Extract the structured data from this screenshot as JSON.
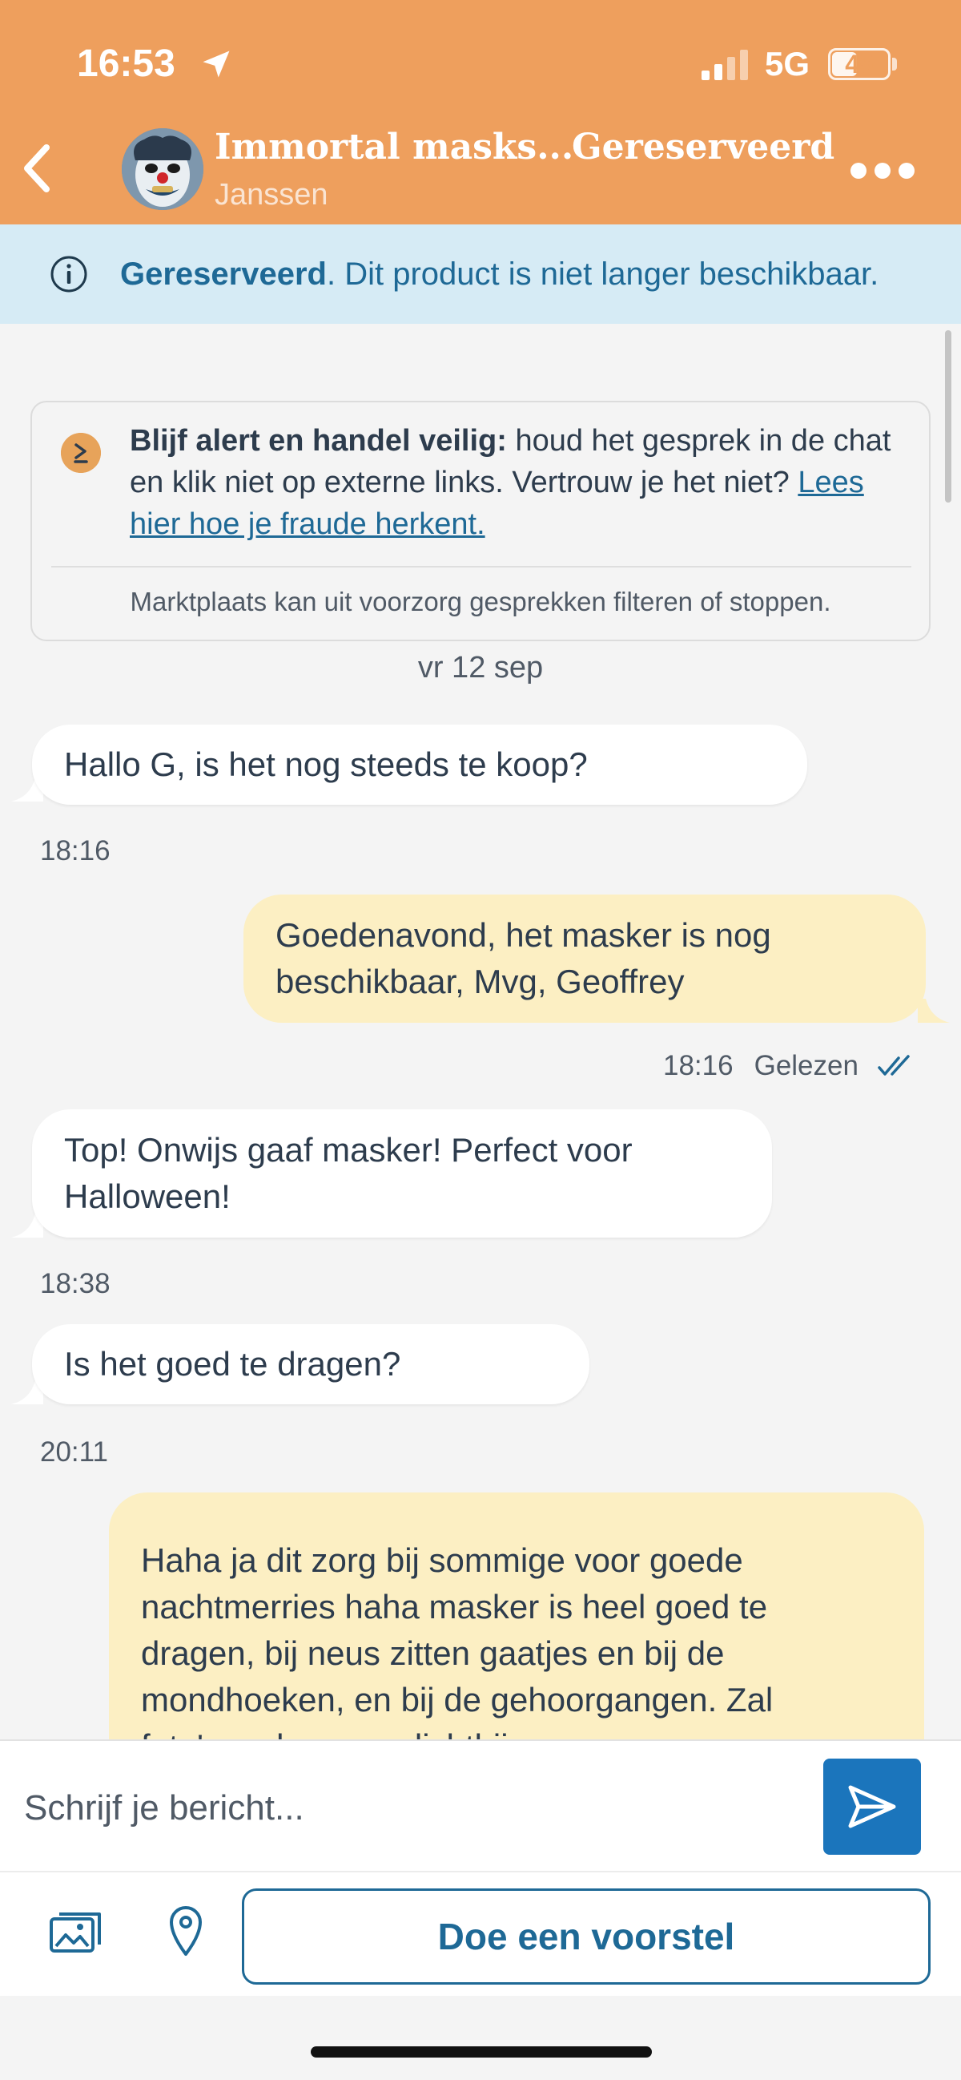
{
  "status_bar": {
    "time": "16:53",
    "network": "5G",
    "battery": "45",
    "battery_level": 0.45
  },
  "header": {
    "title": "Immortal masks...",
    "subtitle": "Janssen",
    "status": "Gereserveerd"
  },
  "banner": {
    "bold": "Gereserveerd",
    "text": ". Dit product is niet langer beschikbaar."
  },
  "safety": {
    "bold": "Blijf alert en handel veilig:",
    "text": " houd het gesprek in de chat en klik niet op externe links. Vertrouw je het niet? ",
    "link": "Lees hier hoe je fraude herkent.",
    "note": "Marktplaats kan uit voorzorg gesprekken filteren of stoppen."
  },
  "date_separator": "vr 12 sep",
  "messages": [
    {
      "direction": "in",
      "text": "Hallo G, is het nog steeds te koop?",
      "time": "18:16"
    },
    {
      "direction": "out",
      "line1": "Goedenavond, het masker is nog",
      "line2": "beschikbaar, Mvg, Geoffrey",
      "time": "18:16",
      "status": "Gelezen"
    },
    {
      "direction": "in",
      "line1": "Top! Onwijs gaaf masker! Perfect voor",
      "line2": "Halloween!",
      "time": "18:38"
    },
    {
      "direction": "in",
      "text": "Is het goed te dragen?",
      "time": "20:11"
    },
    {
      "direction": "out",
      "lines": [
        "Haha ja dit zorg bij sommige voor goede",
        "nachtmerries haha masker is heel goed te",
        "dragen, bij neus zitten gaatjes en bij de",
        "mondhoeken, en bij de gehoorgangen. Zal",
        "foto's maken van dichtbij"
      ]
    }
  ],
  "composer": {
    "placeholder": "Schrijf je bericht..."
  },
  "actions": {
    "offer_label": "Doe een voorstel"
  },
  "colors": {
    "header": "#ee9f5d",
    "banner": "#d6ebf5",
    "accent": "#1e6996",
    "outgoing": "#fcefc3",
    "send": "#1b75bc"
  }
}
